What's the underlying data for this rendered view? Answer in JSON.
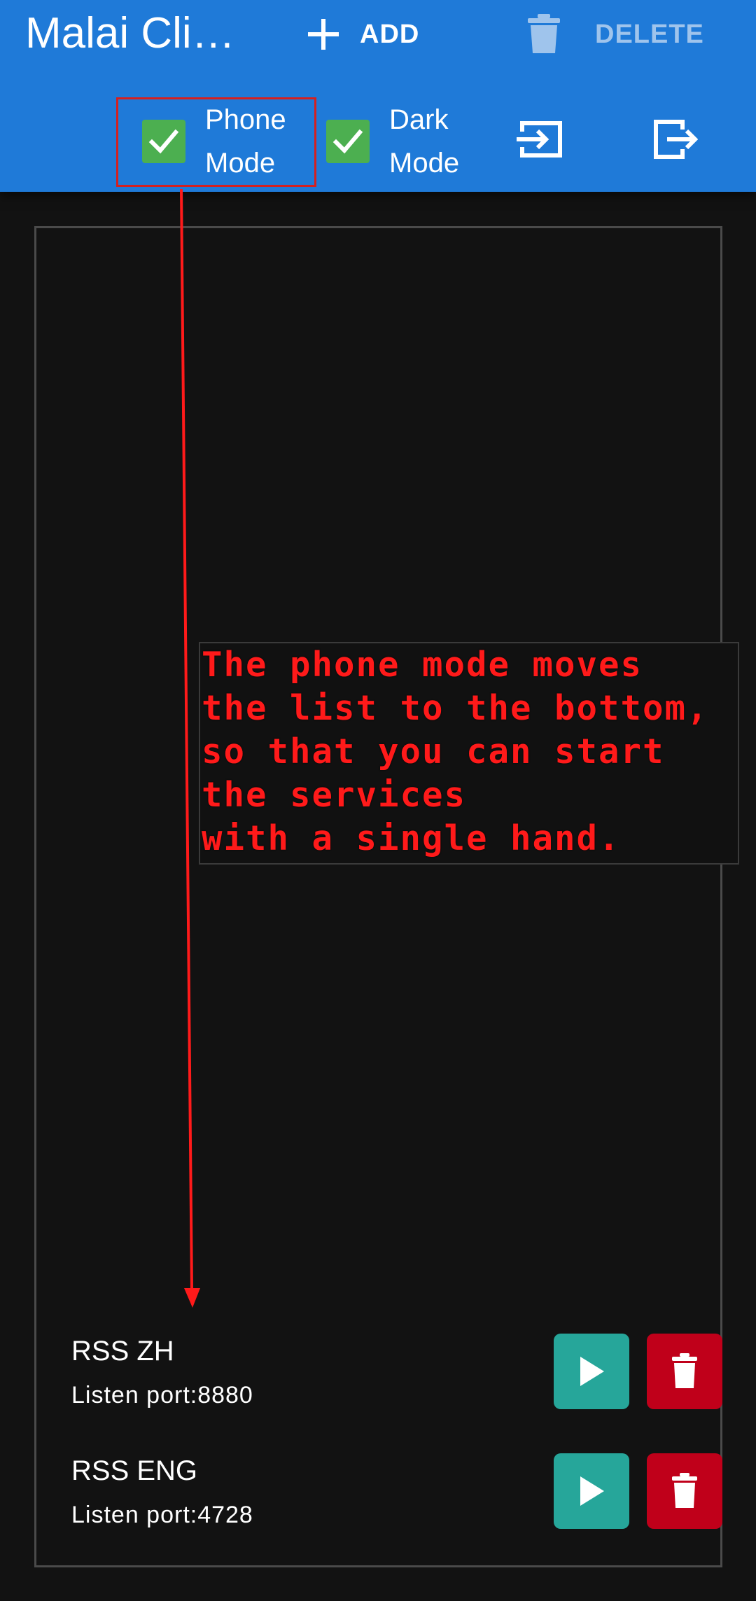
{
  "app": {
    "title": "Malai Cli…"
  },
  "toolbar": {
    "add_label": "ADD",
    "delete_label": "DELETE",
    "add_icon": "plus-icon",
    "delete_icon": "trash-icon"
  },
  "options": {
    "phone_mode": {
      "line1": "Phone",
      "line2": "Mode",
      "checked": true
    },
    "dark_mode": {
      "line1": "Dark",
      "line2": "Mode",
      "checked": true
    },
    "import_icon": "import-icon",
    "export_icon": "export-icon"
  },
  "services": [
    {
      "name": "RSS ZH",
      "port_text": "Listen port:8880"
    },
    {
      "name": "RSS ENG",
      "port_text": "Listen port:4728"
    }
  ],
  "annotation": {
    "lines": [
      "The phone mode moves",
      "the list to the bottom,",
      "so that you can start",
      "the services",
      "with a single hand."
    ]
  },
  "colors": {
    "appbar": "#1f7ad8",
    "background": "#121212",
    "checkbox": "#4caf50",
    "play_button": "#26a69a",
    "delete_button": "#c0001a",
    "annotation": "#ff1a1a"
  }
}
